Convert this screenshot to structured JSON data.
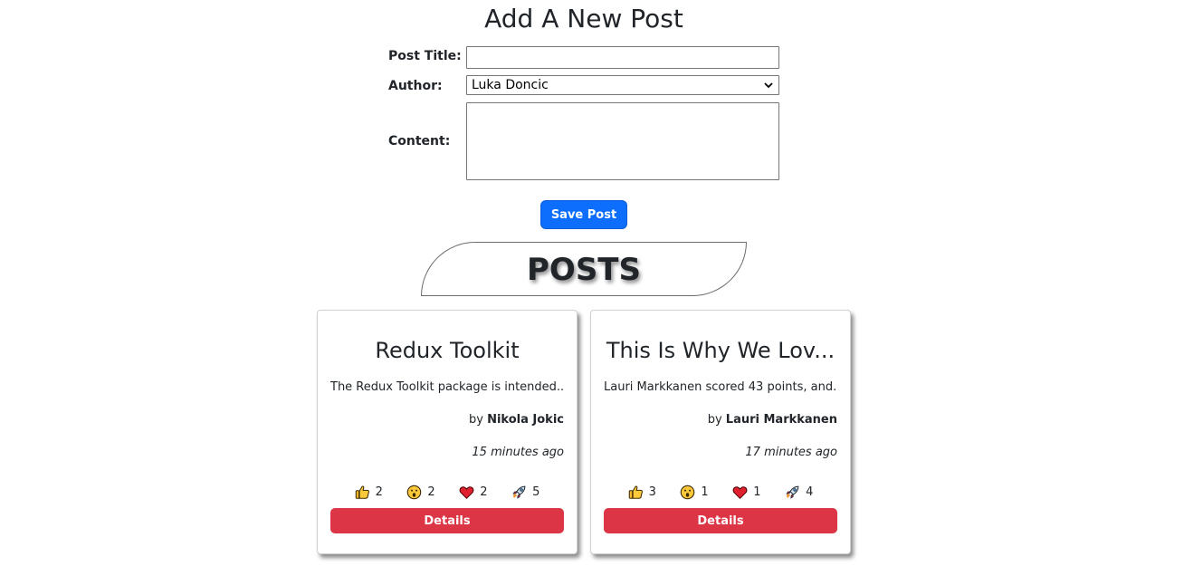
{
  "form": {
    "heading": "Add A New Post",
    "title_label": "Post Title:",
    "title_value": "",
    "author_label": "Author:",
    "author_selected": "Luka Doncic",
    "content_label": "Content:",
    "content_value": "",
    "save_label": "Save Post"
  },
  "posts_heading": "POSTS",
  "posts": [
    {
      "title": "Redux Toolkit",
      "excerpt": "The Redux Toolkit package is intended...",
      "by": "by",
      "author": "Nikola Jokic",
      "time": "15 minutes ago",
      "reactions": {
        "thumbs_up": "2",
        "wow": "2",
        "heart": "2",
        "rocket": "5"
      },
      "details_label": "Details"
    },
    {
      "title": "This Is Why We Lov...",
      "excerpt": "Lauri Markkanen scored 43 points, and...",
      "by": "by",
      "author": "Lauri Markkanen",
      "time": "17 minutes ago",
      "reactions": {
        "thumbs_up": "3",
        "wow": "1",
        "heart": "1",
        "rocket": "4"
      },
      "details_label": "Details"
    }
  ],
  "icons": {
    "thumbs_up": "thumbs-up-icon",
    "wow": "wow-face-icon",
    "heart": "heart-icon",
    "rocket": "rocket-icon",
    "chevron": "chevron-down-icon"
  },
  "colors": {
    "primary": "#0d6efd",
    "danger": "#dc3545"
  }
}
